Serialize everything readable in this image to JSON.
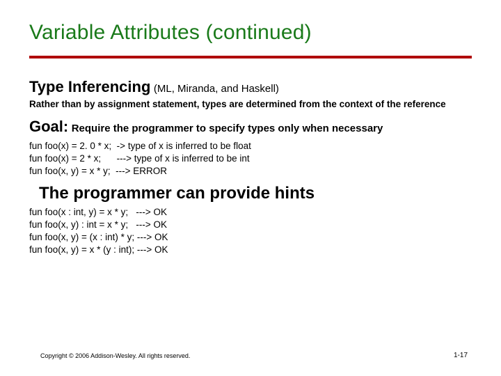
{
  "title": "Variable Attributes (continued)",
  "section1": {
    "heading": "Type Inferencing",
    "sub": "(ML, Miranda, and Haskell)",
    "para": "Rather than by assignment statement, types are determined from the context of the reference"
  },
  "goal": {
    "heading": "Goal:",
    "text": "Require the programmer to specify types only when necessary"
  },
  "code1": "fun foo(x) = 2. 0 * x;  -> type of x is inferred to be float\nfun foo(x) = 2 * x;      ---> type of x is inferred to be int\nfun foo(x, y) = x * y;  ---> ERROR",
  "hints": "The programmer can provide hints",
  "code2": "fun foo(x : int, y) = x * y;   ---> OK\nfun foo(x, y) : int = x * y;   ---> OK\nfun foo(x, y) = (x : int) * y; ---> OK\nfun foo(x, y) = x * (y : int); ---> OK",
  "footer": {
    "copyright": "Copyright © 2006 Addison-Wesley. All rights reserved.",
    "pagenum": "1-17"
  }
}
